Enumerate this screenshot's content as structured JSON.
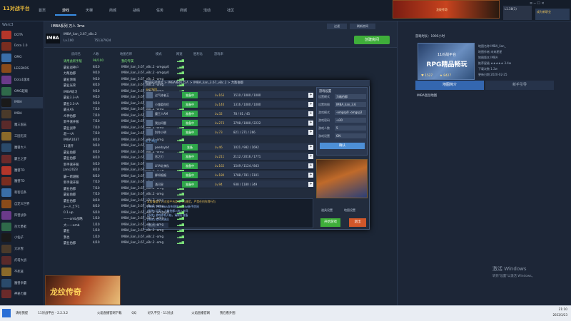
{
  "app": {
    "logo": "11对战平台",
    "user": "L1.38(1)",
    "promo_text": "成为新职业",
    "win_buttons": "≡ ─ ☐ ✕"
  },
  "nav": {
    "tabs": [
      "首页",
      "游戏",
      "天梯",
      "商城",
      "战绩",
      "任务",
      "商城",
      "活动",
      "社区"
    ],
    "active": "游戏"
  },
  "banner": {
    "text": "龙纹传奇"
  },
  "sidebar": {
    "header": "Warc3",
    "items": [
      "DOTA",
      "Dota 1.0",
      "OMG",
      "LEGENDS",
      "Dota1版本",
      "OMG超级",
      "IMBA",
      "IMBA",
      "魔三国志",
      "三国无双",
      "魔兽大人",
      "霸王之梦",
      "魔兽TD",
      "魔兽TD",
      "刺客信条",
      "自定义世界",
      "阵营战争",
      "百大勇者",
      "小仙子",
      "大冰雪",
      "灯塔大战",
      "不死族",
      "魔兽争霸",
      "神秘力量"
    ],
    "active_index": 6
  },
  "room": {
    "logo": "IMBA",
    "title": "IMBA系列 万人 3ms",
    "map_version": "IMBA_lian_3.67_vBc.2",
    "level": "Lv.100",
    "online": "7513/7924",
    "create_btn": "创建房间",
    "btn_a": "过滤",
    "btn_b": "刷新房间"
  },
  "table": {
    "headers": [
      "房间名",
      "人数",
      "地图名称",
      "模式",
      "网速",
      "胜利比",
      "游戏率"
    ],
    "rows": [
      [
        "请用此新手版",
        "98/100",
        "我的专属",
        ""
      ],
      [
        "霸业战神户",
        "8/10",
        "IMBA_lian_3.67_vBc.2",
        "-omgsp0"
      ],
      [
        "力敌伯都",
        "9/10",
        "IMBA_lian_3.67_vBc.2",
        "-omgsp0"
      ],
      [
        "霸业领域",
        "9/10",
        "IMBA_lian_3.67_vBc.2",
        "-omg"
      ],
      [
        "霸业光荣",
        "8/10",
        "IMBA_lian_3.67_vBc.2",
        "-omg"
      ],
      [
        "IMBA练习",
        "9/10",
        "IMBA_lian_3.67_vBc.2",
        "-omg"
      ],
      [
        "霸业3.3-IA",
        "9/10",
        "IMBA_lian_3.67_vBc.2",
        "-omg"
      ],
      [
        "霸业3.3-IA",
        "9/10",
        "IMBA_lian_3.67_vBc.2",
        "-omg"
      ],
      [
        "霸王AS",
        "7/10",
        "IMBA_lian_3.67_vBc.2",
        "-omg"
      ],
      [
        "众神伯都",
        "7/10",
        "IMBA_lian_3.67_vBc.2",
        "-omg"
      ],
      [
        "新手速开服",
        "7/10",
        "IMBA_lian_3.67_vBc.2",
        "-omg"
      ],
      [
        "霸业战神",
        "7/10",
        "IMBA_lian_3.67_vBc.2",
        "-omg"
      ],
      [
        "超一-IA",
        "7/10",
        "IMBA_lian_3.67_vBc.2",
        "-omg"
      ],
      [
        "IMBA1037",
        "8/10",
        "IMBA_lian_3.67_vBc.2",
        "-omg"
      ],
      [
        "11速开",
        "9/10",
        "IMBA_lian_3.67_vBc.2",
        "-omg"
      ],
      [
        "霸业伯都",
        "8/10",
        "IMBA_lian_3.67_vBc.2",
        "-omg"
      ],
      [
        "霸业伯都",
        "8/10",
        "IMBA_lian_3.67_vBc.2",
        "-omg"
      ],
      [
        "新手速开服",
        "6/10",
        "IMBA_lian_3.67_vBc.2",
        "-omg"
      ],
      [
        "Jans2023",
        "8/10",
        "IMBA_lian_3.67_vBc.2",
        "-omg"
      ],
      [
        "霸一跨越服",
        "8/10",
        "IMBA_lian_3.67_vBc.2",
        "-omg"
      ],
      [
        "新手速开服",
        "7/10",
        "IMBA_lian_3.67_vBc.2",
        "-omg"
      ],
      [
        "霸业伯都",
        "7/10",
        "IMBA_lian_3.67_vBc.2",
        "-omg"
      ],
      [
        "霸业伯都",
        "7/10",
        "IMBA_lian_3.67_vBc.2",
        "-omg"
      ],
      [
        "霸业伯都",
        "8/10",
        "IMBA_lian_3.67_vBc.2",
        "-omg"
      ],
      [
        "a—人上下1",
        "8/10",
        "IMBA_lian_3.67_vBc.2",
        "-omg"
      ],
      [
        "0.1.up",
        "6/10",
        "IMBA_lian_3.67_vBc.2",
        "-omgsp0"
      ],
      [
        "——omb战略",
        "1/10",
        "IMBA_lian_3.67_vBc.2",
        "-omg"
      ],
      [
        "大——omb",
        "1/10",
        "IMBA_lian_3.67_vBc.2",
        "-omg"
      ],
      [
        "霸业",
        "1/10",
        "IMBA_lian_3.67_vBc.2",
        "-omg"
      ],
      [
        "我也",
        "1/10",
        "IMBA_lian_3.67_vBc.2",
        "-omg"
      ],
      [
        "霸业伯都",
        "4/10",
        "IMBA_lian_3.67_vBc.2",
        "-omg"
      ]
    ]
  },
  "dialog": {
    "title": "地域名对单位 > IMBA系列 万人 > IMBA_lian_3.67_vBc.2 > 力敌伯都",
    "team_a_label": "天灾军团",
    "team_b_label": "近卫军团",
    "players": [
      {
        "name": "过气修者王",
        "status": "准备中",
        "lv": "Lv.163",
        "stats": "1510 / 1080 / 1080"
      },
      {
        "name": "小雏菊你们",
        "status": "准备中",
        "lv": "Lv.140",
        "stats": "1316 / 1080 / 1080"
      },
      {
        "name": "魔王人AM",
        "status": "准备中",
        "lv": "Lv.32",
        "stats": "78 / 61 / 45"
      },
      {
        "name": "我自问题",
        "status": "准备中",
        "lv": "Lv.273",
        "stats": "3798 / 1080 / 2222"
      },
      {
        "name": "别作小明",
        "status": "准备中",
        "lv": "Lv.73",
        "stats": "821 / 271 / 266"
      },
      {
        "name": "peedaybd",
        "status": "准备",
        "lv": "Lv.46",
        "stats": "1021 / 982 / 1692"
      },
      {
        "name": "恶之刃",
        "status": "准备中",
        "lv": "Lv.211",
        "stats": "2112 / 2016 / 1771"
      },
      {
        "name": "LIYA北神队",
        "status": "准备中",
        "lv": "Lv.162",
        "stats": "1549 / 1124 / 843"
      },
      {
        "name": "柳如烟烟",
        "status": "准备中",
        "lv": "Lv.180",
        "stats": "1788 / 781 / 1101"
      },
      {
        "name": "涌河泉",
        "status": "准备中",
        "lv": "Lv.94",
        "stats": "938 / 1180 / 349"
      }
    ],
    "settings": {
      "title": "游戏设置",
      "labels": [
        "设置模式",
        "设置地图",
        "游戏模式",
        "游戏密码",
        "游戏人数",
        "游戏设置"
      ],
      "values": [
        "力敌伯都",
        "IMBA_lian_3.6",
        "-omgsp0 -omgsp2",
        "-x30",
        "5",
        "ON"
      ],
      "confirm": "确认"
    },
    "chat_lines": [
      "[系统] 主机IMBA发布规则：IMBA新手房间",
      "[系统] 玩家<-力敌伯都>加入房间",
      "[系统] 游戏即将开始，请做好准备",
      "[系统] 房间已满员"
    ],
    "chat_tip": "本房请遵守11对战平台游戏行为规范，严禁任何作弊行为",
    "chat_input": "说点什么",
    "btn_a": "道具设置",
    "btn_b": "地图设置",
    "start": "开始游戏",
    "exit": "退出"
  },
  "right": {
    "top_label": "游戏时长：1995小时",
    "game_title": "11对战平台",
    "game_sub": "RPG精品畅玩",
    "likes": "1527",
    "views": "8427",
    "info": [
      "地图名称 IMBA_lian_",
      "地图作者 未来星星",
      "地图版本 IMBA",
      "推荐星级 ★★★★★ 3.4w",
      "下载次数 1.2w",
      "更新日期 2020-02-25"
    ],
    "tabs": [
      "地图简介",
      "新手引导"
    ],
    "desc": "IMBA混战地图"
  },
  "ad": {
    "title": "龙纹传奇"
  },
  "taskbar": {
    "items": [
      "请给我提",
      "11对战平台 - 2.2.3.2",
      "火焰直播官网下载",
      "QQ",
      "好久不见 - 11对战",
      "火焰直播官网",
      "我在看外围"
    ],
    "time": "21:10",
    "date": "2023/3/23"
  },
  "watermark": {
    "line1": "激活 Windows",
    "line2": "转到\"设置\"以激活 Windows。"
  }
}
